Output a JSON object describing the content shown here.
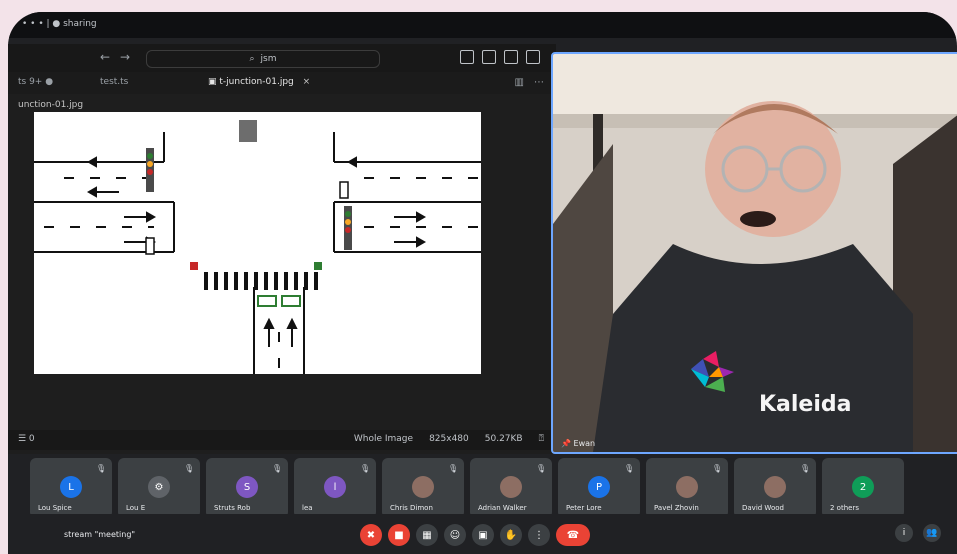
{
  "window": {
    "title": "• • • | ● sharing"
  },
  "editor": {
    "search": "jsm",
    "tabs": [
      {
        "label": "ts 9+ ●"
      },
      {
        "label": "test.ts"
      },
      {
        "label": "t-junction-01.jpg"
      }
    ],
    "tab_close": "×",
    "breadcrumb": "unction-01.jpg",
    "status_left": "☰ 0",
    "status_mode": "Whole Image",
    "status_size": "825x480",
    "status_bytes": "50.27KB"
  },
  "camera": {
    "name": "Ewan",
    "brand": "Kaleida"
  },
  "participants": [
    {
      "initial": "L",
      "name": "Lou Spice",
      "color": "#1a73e8"
    },
    {
      "initial": "",
      "name": "Lou E",
      "color": "#5f6368",
      "icon": "bicycle-icon"
    },
    {
      "initial": "S",
      "name": "Struts Rob",
      "color": "#7e57c2"
    },
    {
      "initial": "l",
      "name": "lea",
      "color": "#7e57c2"
    },
    {
      "initial": "",
      "name": "Chris Dimon",
      "color": "#8d6e63"
    },
    {
      "initial": "",
      "name": "Adrian Walker",
      "color": "#8d6e63"
    },
    {
      "initial": "P",
      "name": "Peter Lore",
      "color": "#1a73e8"
    },
    {
      "initial": "",
      "name": "Pavel Zhovin",
      "color": "#8d6e63"
    },
    {
      "initial": "",
      "name": "David Wood",
      "color": "#8d6e63"
    },
    {
      "initial": "2",
      "name": "2 others",
      "color": "#0f9d58"
    }
  ],
  "controls": {
    "meeting": "stream \"meeting\"",
    "end_icon": "phone-end-icon"
  },
  "colors": {
    "accent": "#6ea7ff",
    "danger": "#ea4335",
    "tile": "#3c4043"
  }
}
